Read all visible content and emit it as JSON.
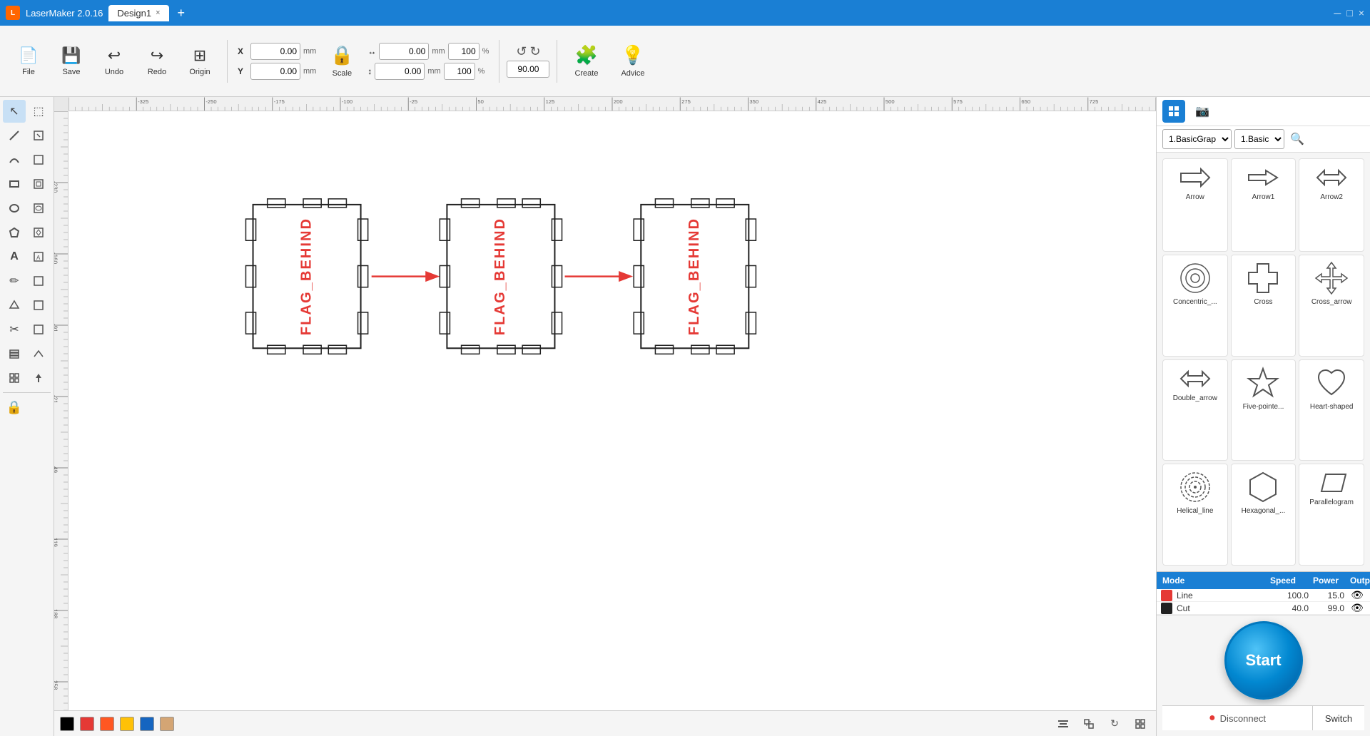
{
  "titlebar": {
    "app_name": "LaserMaker 2.0.16",
    "tab_name": "Design1",
    "close_icon": "×",
    "add_tab_icon": "+",
    "min_icon": "─",
    "max_icon": "□",
    "close_win_icon": "×"
  },
  "toolbar": {
    "file_label": "File",
    "save_label": "Save",
    "undo_label": "Undo",
    "redo_label": "Redo",
    "origin_label": "Origin",
    "scale_label": "Scale",
    "create_label": "Create",
    "advice_label": "Advice",
    "x_label": "X",
    "y_label": "Y",
    "x_value": "0.00",
    "y_value": "0.00",
    "x_unit": "mm",
    "y_unit": "mm",
    "w_value": "0.00",
    "h_value": "0.00",
    "w_unit": "mm",
    "h_unit": "mm",
    "w_pct": "100",
    "h_pct": "100",
    "rotation_value": "90.00",
    "lock_icon": "🔒"
  },
  "shapes_panel": {
    "category_1": "1.BasicGrap",
    "category_2": "1.Basic",
    "shapes": [
      {
        "name": "Arrow",
        "shape": "arrow"
      },
      {
        "name": "Arrow1",
        "shape": "arrow1"
      },
      {
        "name": "Arrow2",
        "shape": "arrow2"
      },
      {
        "name": "Concentric_...",
        "shape": "concentric"
      },
      {
        "name": "Cross",
        "shape": "cross"
      },
      {
        "name": "Cross_arrow",
        "shape": "cross_arrow"
      },
      {
        "name": "Double_arrow",
        "shape": "double_arrow"
      },
      {
        "name": "Five-pointe...",
        "shape": "five_point"
      },
      {
        "name": "Heart-shaped",
        "shape": "heart"
      },
      {
        "name": "Helical_line",
        "shape": "helical"
      },
      {
        "name": "Hexagonal_...",
        "shape": "hexagonal"
      },
      {
        "name": "Parallelogram",
        "shape": "parallelogram"
      }
    ]
  },
  "layer_table": {
    "headers": [
      "Mode",
      "Speed",
      "Power",
      "Output"
    ],
    "rows": [
      {
        "color": "#e53935",
        "name": "Line",
        "speed": "100.0",
        "power": "15.0"
      },
      {
        "color": "#212121",
        "name": "Cut",
        "speed": "40.0",
        "power": "99.0"
      }
    ]
  },
  "controls": {
    "start_label": "Start",
    "disconnect_label": "Disconnect",
    "switch_label": "Switch"
  },
  "bottom_colors": [
    "#e53935",
    "#ff5722",
    "#ffc107",
    "#1565c0",
    "#e0c0a0"
  ],
  "left_tools": [
    {
      "icon": "↖",
      "name": "select"
    },
    {
      "icon": "⬚",
      "name": "select-area"
    },
    {
      "icon": "╱",
      "name": "line"
    },
    {
      "icon": "⬚",
      "name": "cut-line"
    },
    {
      "icon": "〜",
      "name": "curve"
    },
    {
      "icon": "⬚",
      "name": "curve-tool"
    },
    {
      "icon": "▭",
      "name": "rectangle"
    },
    {
      "icon": "⬚",
      "name": "rect-tool"
    },
    {
      "icon": "○",
      "name": "ellipse"
    },
    {
      "icon": "⬚",
      "name": "ellipse-tool"
    },
    {
      "icon": "△",
      "name": "polygon"
    },
    {
      "icon": "⬚",
      "name": "poly-tool"
    },
    {
      "icon": "A",
      "name": "text"
    },
    {
      "icon": "⬚",
      "name": "text-tool"
    },
    {
      "icon": "✏",
      "name": "pen"
    },
    {
      "icon": "⬚",
      "name": "pen-tool"
    },
    {
      "icon": "◇",
      "name": "fill"
    },
    {
      "icon": "⬚",
      "name": "fill-tool"
    },
    {
      "icon": "✂",
      "name": "eraser"
    },
    {
      "icon": "⬚",
      "name": "eraser-tool"
    },
    {
      "icon": "⬚",
      "name": "layer"
    },
    {
      "icon": "⬚",
      "name": "layer-tool"
    },
    {
      "icon": "⬚",
      "name": "array"
    },
    {
      "icon": "⬚",
      "name": "array-tool"
    },
    {
      "icon": "🔒",
      "name": "lock"
    }
  ]
}
